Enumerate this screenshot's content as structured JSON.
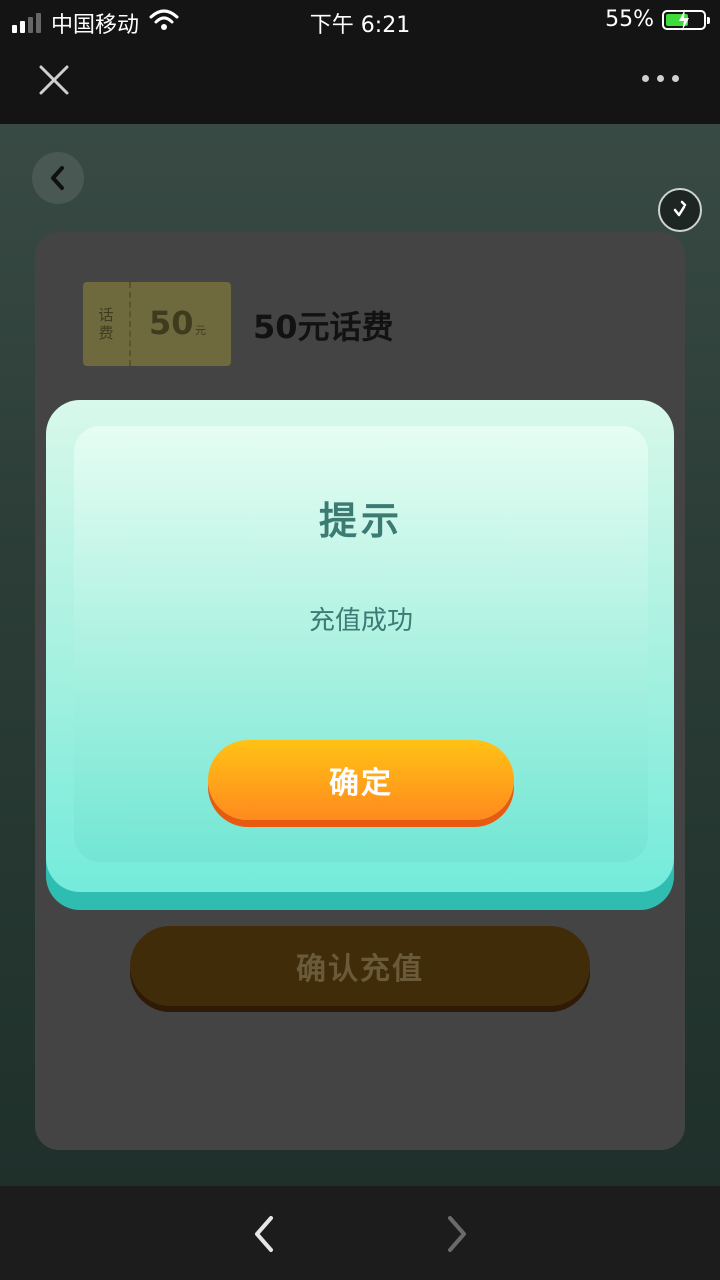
{
  "status_bar": {
    "carrier": "中国移动",
    "time": "下午 6:21",
    "battery_percent": "55%",
    "icons": [
      "signal-icon",
      "wifi-icon",
      "battery-charging-icon"
    ]
  },
  "nav_bar": {
    "icons": [
      "close-icon",
      "more-icon"
    ]
  },
  "page": {
    "back_icon": "chevron-left-icon",
    "share_icon": "share-icon",
    "ticket": {
      "side_label": "话费",
      "value": "50",
      "unit": "元"
    },
    "product_title": "50元话费",
    "confirm_recharge_label": "确认充值"
  },
  "modal": {
    "title": "提示",
    "message": "充值成功",
    "ok_label": "确定"
  },
  "bottom_bar": {
    "icons": [
      "back-arrow-icon",
      "forward-arrow-icon"
    ]
  },
  "colors": {
    "modal_bg": "#9ff0df",
    "modal_text": "#3c7a74",
    "ok_button_top": "#ffc214",
    "ok_button_bottom": "#ff8a1e",
    "overlay_bg": "#2c3d37"
  }
}
